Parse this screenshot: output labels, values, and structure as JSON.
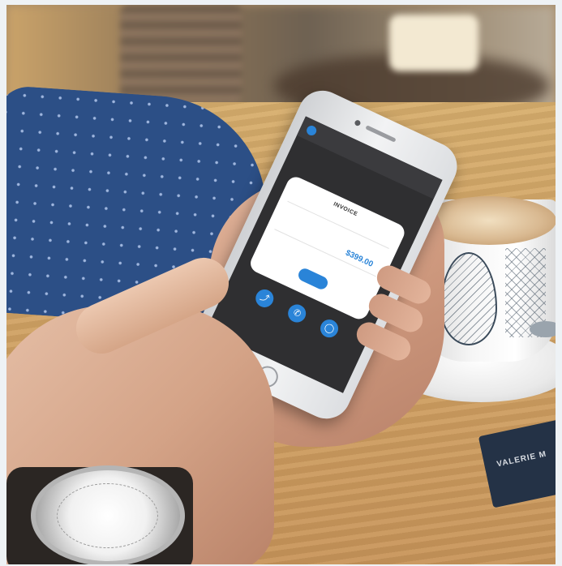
{
  "phone_screen": {
    "app_name": "",
    "heading": "",
    "description": "",
    "invoice": {
      "title": "INVOICE",
      "subtitle": "",
      "amount_label": "",
      "amount": "$399.00",
      "currency": "",
      "button_label": ""
    },
    "actions": [
      {
        "icon": "share-icon",
        "glyph": "⤴",
        "label": ""
      },
      {
        "icon": "phone-icon",
        "glyph": "✆",
        "label": ""
      },
      {
        "icon": "chat-icon",
        "glyph": "◯",
        "label": ""
      }
    ],
    "footer_text": "",
    "footer_link": ""
  },
  "booklet": {
    "text": "VALERIE M"
  },
  "colors": {
    "accent": "#2a84d8",
    "screen_bg": "#2f2f31",
    "sleeve": "#2c4f86"
  }
}
